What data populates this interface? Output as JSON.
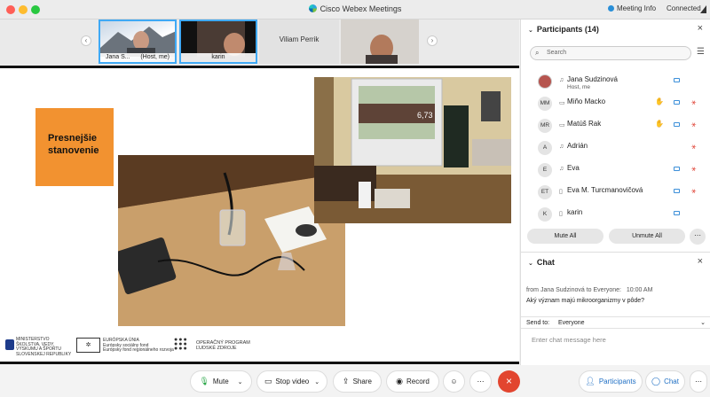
{
  "window": {
    "title": "Cisco Webex Meetings",
    "meeting_info": "Meeting Info",
    "status": "Connected"
  },
  "video_strip": {
    "tiles": [
      {
        "name": "Jana S...",
        "role": "(Host, me)"
      },
      {
        "name": "karin"
      },
      {
        "name": "Viliam Perrik"
      },
      {
        "name": ""
      }
    ]
  },
  "slide": {
    "heading": "Presnejšie stanovenie",
    "logos": [
      {
        "lines": [
          "MINISTERSTVO",
          "ŠKOLSTVA, VEDY,",
          "VÝSKUMU A ŠPORTU",
          "SLOVENSKEJ REPUBLIKY"
        ]
      },
      {
        "lines": [
          "EURÓPSKA ÚNIA",
          "Európsky sociálny fond",
          "Európsky fond regionálneho rozvoja"
        ]
      },
      {
        "lines": [
          "OPERAČNÝ PROGRAM",
          "ĽUDSKÉ ZDROJE"
        ]
      }
    ],
    "projector_readout": "6,73"
  },
  "participants": {
    "title": "Participants (14)",
    "search_placeholder": "Search",
    "list": [
      {
        "initials": "",
        "name": "Jana Sudzinová",
        "sub": "Host, me",
        "video": "on",
        "mic": "on"
      },
      {
        "initials": "MM",
        "name": "Miňo Macko",
        "video": "on",
        "mic": "muted"
      },
      {
        "initials": "MR",
        "name": "Matúš Rak",
        "video": "on",
        "mic": "muted"
      },
      {
        "initials": "A",
        "name": "Adrián",
        "video": "",
        "mic": "muted"
      },
      {
        "initials": "E",
        "name": "Eva",
        "video": "on",
        "mic": "muted"
      },
      {
        "initials": "ET",
        "name": "Eva M. Turcmanovičová",
        "video": "on",
        "mic": "muted"
      },
      {
        "initials": "K",
        "name": "karin",
        "video": "on",
        "mic": ""
      }
    ],
    "mute_all": "Mute All",
    "unmute_all": "Unmute All"
  },
  "chat": {
    "title": "Chat",
    "from": "from Jana Sudzinová to Everyone:",
    "time": "10:00 AM",
    "message": "Aký význam majú mikroorganizmy v pôde?",
    "send_to_label": "Send to:",
    "send_to_value": "Everyone",
    "input_placeholder": "Enter chat message here"
  },
  "controls": {
    "mute": "Mute",
    "stop_video": "Stop video",
    "share": "Share",
    "record": "Record",
    "participants": "Participants",
    "chat": "Chat"
  }
}
